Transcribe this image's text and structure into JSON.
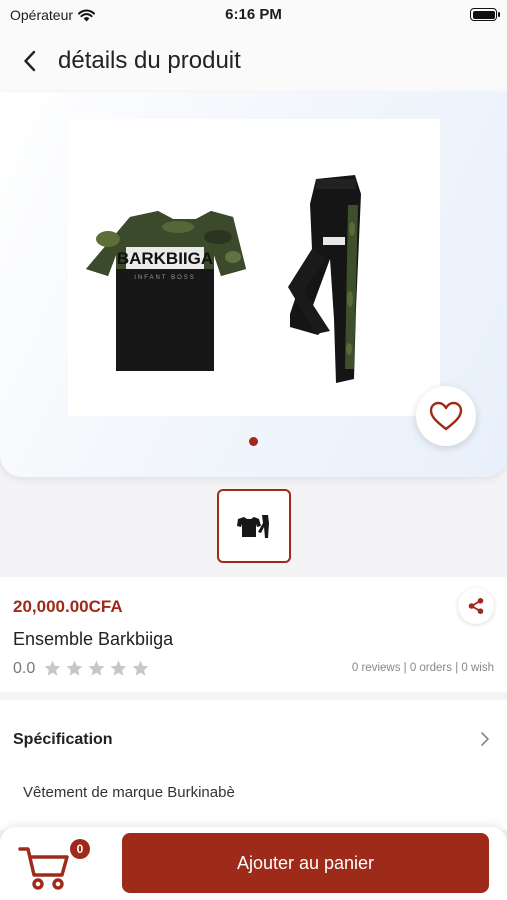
{
  "status_bar": {
    "carrier": "Opérateur",
    "time": "6:16 PM",
    "battery_level": 1.0
  },
  "header": {
    "title": "détails du produit",
    "back_icon": "chevron-left-icon"
  },
  "gallery": {
    "image_alt": "BARKBIIGA",
    "image_caption": "INFANT BOSS",
    "page_count": 1,
    "active_index": 0,
    "favorite_icon": "heart-outline-icon"
  },
  "product": {
    "price": "20,000.00CFA",
    "name": "Ensemble Barkbiiga",
    "rating": "0.0",
    "stars_filled": 0,
    "stars_total": 5,
    "stats": "0 reviews | 0 orders | 0 wish",
    "share_icon": "share-icon"
  },
  "specification": {
    "title": "Spécification",
    "description": "Vêtement de marque Burkinabè"
  },
  "cart": {
    "count": "0",
    "icon": "cart-icon"
  },
  "actions": {
    "add_to_cart": "Ajouter au panier"
  },
  "colors": {
    "accent": "#9e2a1a",
    "star_empty": "#c7c7c7"
  }
}
